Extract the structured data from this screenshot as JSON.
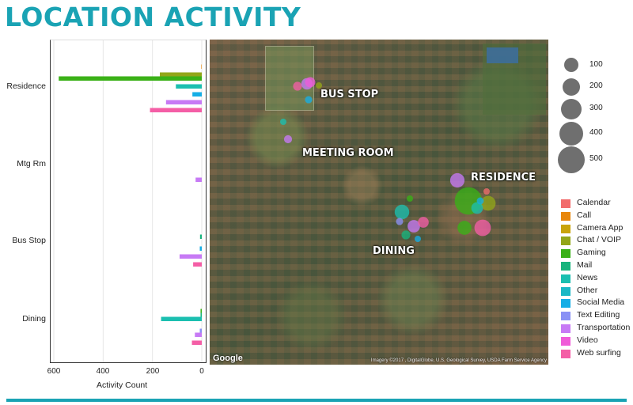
{
  "page": {
    "title": "LOCATION ACTIVITY"
  },
  "chart_data": {
    "type": "bar",
    "orientation": "horizontal",
    "reversed_x": true,
    "xlabel": "Activity Count",
    "xlim": [
      0,
      600
    ],
    "xticks": [
      "600",
      "400",
      "200",
      "0"
    ],
    "grid": true,
    "categories": [
      "Residence",
      "Mtg Rm",
      "Bus Stop",
      "Dining"
    ],
    "series": [
      {
        "name": "Calendar",
        "color": "#f26d6d",
        "values": [
          0,
          0,
          0,
          0
        ]
      },
      {
        "name": "Call",
        "color": "#e8870c",
        "values": [
          2,
          0,
          0,
          0
        ]
      },
      {
        "name": "Camera App",
        "color": "#c9a40a",
        "values": [
          0,
          0,
          0,
          0
        ]
      },
      {
        "name": "Chat / VOIP",
        "color": "#93a619",
        "values": [
          170,
          0,
          0,
          0
        ]
      },
      {
        "name": "Gaming",
        "color": "#3ab117",
        "values": [
          580,
          0,
          0,
          5
        ]
      },
      {
        "name": "Mail",
        "color": "#18b47d",
        "values": [
          0,
          0,
          7,
          5
        ]
      },
      {
        "name": "News",
        "color": "#1bbfb0",
        "values": [
          105,
          0,
          0,
          165
        ]
      },
      {
        "name": "Other",
        "color": "#1ab8c6",
        "values": [
          0,
          0,
          0,
          0
        ]
      },
      {
        "name": "Social Media",
        "color": "#16aee6",
        "values": [
          38,
          0,
          8,
          0
        ]
      },
      {
        "name": "Text Editing",
        "color": "#8a91f5",
        "values": [
          0,
          0,
          0,
          8
        ]
      },
      {
        "name": "Transportation",
        "color": "#c77af5",
        "values": [
          145,
          25,
          90,
          28
        ]
      },
      {
        "name": "Video",
        "color": "#f05bd8",
        "values": [
          0,
          0,
          0,
          0
        ]
      },
      {
        "name": "Web surfing",
        "color": "#f45ea6",
        "values": [
          210,
          0,
          35,
          40
        ]
      }
    ]
  },
  "map": {
    "labels": [
      "BUS STOP",
      "MEETING ROOM",
      "RESIDENCE",
      "DINING"
    ],
    "google": "Google",
    "credit": "Imagery ©2017 , DigitalGlobe, U.S. Geological Survey, USDA Farm Service Agency",
    "bubbles": [
      {
        "category": "Web surfing",
        "value": 60
      },
      {
        "category": "Transportation",
        "value": 100
      },
      {
        "category": "Video",
        "value": 80
      },
      {
        "category": "Social Media",
        "value": 40
      },
      {
        "category": "Chat / VOIP",
        "value": 25
      },
      {
        "category": "News",
        "value": 30
      },
      {
        "category": "Transportation",
        "value": 50
      },
      {
        "category": "Transportation",
        "value": 160
      },
      {
        "category": "Gaming",
        "value": 580
      },
      {
        "category": "Chat / VOIP",
        "value": 170
      },
      {
        "category": "News",
        "value": 105
      },
      {
        "category": "Social Media",
        "value": 38
      },
      {
        "category": "Web surfing",
        "value": 210
      },
      {
        "category": "Calendar",
        "value": 20
      },
      {
        "category": "Gaming",
        "value": 150
      },
      {
        "category": "Gaming",
        "value": 20
      },
      {
        "category": "News",
        "value": 165
      },
      {
        "category": "Transportation",
        "value": 120
      },
      {
        "category": "Text Editing",
        "value": 40
      },
      {
        "category": "Web surfing",
        "value": 90
      },
      {
        "category": "Mail",
        "value": 60
      },
      {
        "category": "Social Media",
        "value": 30
      }
    ]
  },
  "size_legend": {
    "values": [
      "100",
      "200",
      "300",
      "400",
      "500"
    ]
  }
}
